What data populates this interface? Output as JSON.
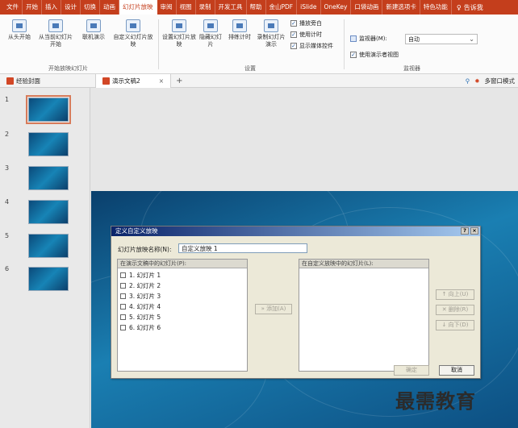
{
  "menu_tabs": [
    "文件",
    "开始",
    "插入",
    "设计",
    "切换",
    "动画",
    "幻灯片放映",
    "审阅",
    "视图",
    "录制",
    "开发工具",
    "帮助",
    "金山PDF",
    "iSlide",
    "OneKey",
    "口袋动画",
    "新建选项卡",
    "特色功能"
  ],
  "active_tab_index": 6,
  "search_label": "告诉我",
  "ribbon": {
    "from_start": "从头开始",
    "from_current": "从当前幻灯片开始",
    "online_present": "联机演示",
    "custom_show": "自定义幻灯片放映",
    "group_start": "开始放映幻灯片",
    "setup_show": "设置幻灯片放映",
    "hide_slide": "隐藏幻灯片",
    "rehearse": "排练计时",
    "record": "录制幻灯片演示",
    "chk_narration": "播放旁白",
    "chk_timings": "使用计时",
    "chk_media": "显示媒体控件",
    "group_setup": "设置",
    "monitor_label": "监视器(M):",
    "monitor_value": "自动",
    "chk_presenter": "使用演示者视图",
    "group_monitor": "监视器"
  },
  "doc_tabs": [
    {
      "label": "经验封面"
    },
    {
      "label": "演示文稿2"
    }
  ],
  "doc_tab_close": "×",
  "doc_tab_add": "+",
  "multiwindow": "多窗口模式",
  "slides": [
    {
      "num": "1"
    },
    {
      "num": "2"
    },
    {
      "num": "3"
    },
    {
      "num": "4"
    },
    {
      "num": "5"
    },
    {
      "num": "6"
    }
  ],
  "dialog": {
    "title": "定义自定义放映",
    "help": "?",
    "close": "×",
    "name_label": "幻灯片放映名称(N):",
    "name_value": "自定义放映 1",
    "left_head": "在演示文稿中的幻灯片(P):",
    "right_head": "在自定义放映中的幻灯片(L):",
    "items": [
      "1. 幻灯片 1",
      "2. 幻灯片 2",
      "3. 幻灯片 3",
      "4. 幻灯片 4",
      "5. 幻灯片 5",
      "6. 幻灯片 6"
    ],
    "add": "» 添加(A)",
    "up": "↑ 向上(U)",
    "delete": "✕ 删除(R)",
    "down": "↓ 向下(D)",
    "ok": "确定",
    "cancel": "取消"
  },
  "watermark": "最需教育"
}
